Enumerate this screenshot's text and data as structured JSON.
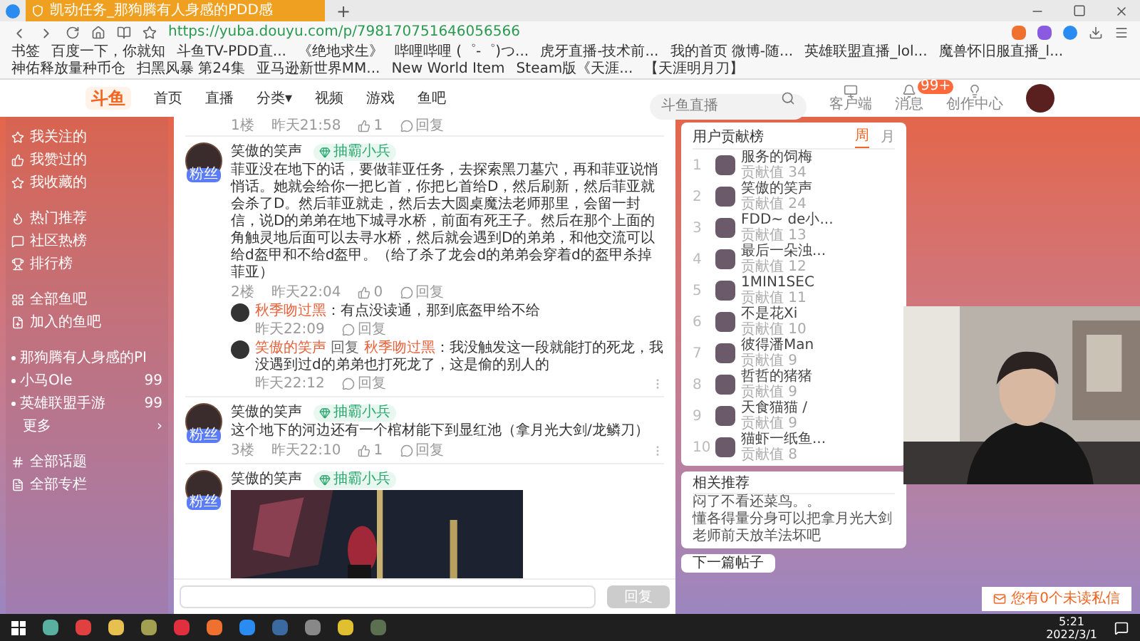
{
  "browser": {
    "tab_title": "凯动任务_那狗腾有人身感的PDD感",
    "new_tab": "+",
    "url": "https://yuba.douyu.com/p/798170751646056566",
    "bookmarks": [
      "书签",
      "百度一下，你就知",
      "斗鱼TV-PDD直...",
      "《绝地求生》",
      "哔哩哔哩 (゜-゜)つ...",
      "虎牙直播-技术前...",
      "我的首页 微博-随...",
      "英雄联盟直播_lol...",
      "魔兽怀旧服直播_l...",
      "神佑释放量种币仓",
      "扫黑风暴 第24集",
      "亚马逊新世界MM...",
      "New World Item",
      "Steam版《天涯...",
      "【天涯明月刀】"
    ]
  },
  "site_header": {
    "logo": "斗鱼",
    "nav": [
      "首页",
      "直播",
      "分类▾",
      "视频",
      "游戏",
      "鱼吧"
    ],
    "search": {
      "placeholder": "斗鱼直播"
    },
    "actions": [
      {
        "label": "客户端"
      },
      {
        "label": "消息",
        "badge": "99+"
      },
      {
        "label": "创作中心"
      }
    ]
  },
  "sidebar": {
    "sections": [
      [
        {
          "label": "我关注的",
          "kind": "link"
        },
        {
          "label": "我赞过的",
          "kind": "link"
        },
        {
          "label": "我收藏的",
          "kind": "link"
        }
      ],
      [
        {
          "label": "热门推荐",
          "kind": "link"
        },
        {
          "label": "社区热榜",
          "kind": "link"
        },
        {
          "label": "排行榜",
          "kind": "link"
        }
      ],
      [
        {
          "label": "全部鱼吧",
          "kind": "link"
        },
        {
          "label": "加入的鱼吧",
          "kind": "link"
        }
      ],
      [
        {
          "label": "那狗腾有人身感的PI",
          "kind": "forum"
        },
        {
          "label": "小马Ole",
          "kind": "forum",
          "count": "99"
        },
        {
          "label": "英雄联盟手游",
          "kind": "forum",
          "count": "99"
        },
        {
          "label": "更多",
          "kind": "more",
          "arrow": "›"
        }
      ],
      [
        {
          "label": "全部话题",
          "kind": "link"
        },
        {
          "label": "全部专栏",
          "kind": "link"
        }
      ]
    ]
  },
  "thread": {
    "top_meta": {
      "floor": "1楼",
      "time": "昨天21:58",
      "likes": "1",
      "reply": "回复"
    },
    "comments": [
      {
        "author": "笑傲的笑声",
        "badge": "抽霸小兵",
        "avatar_tag": "粉丝",
        "text": "菲亚没在地下的话，要做菲亚任务，去探索黑刀墓穴，再和菲亚说悄悄话。她就会给你一把匕首，你把匕首给D，然后刷新，然后菲亚就会杀了D。然后菲亚就走，然后去大圆桌魔法老师那里，会留一封信，说D的弟弟在地下城寻水桥，前面有死王子。然后在那个上面的角触灵地后面可以去寻水桥，然后就会遇到D的弟弟，和他交流可以给d盔甲和不给d盔甲。（给了杀了龙会d的弟弟会穿着d的盔甲杀掉菲亚）",
        "floor": "2楼",
        "time": "昨天22:04",
        "likes": "0",
        "reply": "回复",
        "replies": [
          {
            "author": "秋季吻过黑",
            "text": "：有点没读通，那到底盔甲给不给",
            "time": "昨天22:09",
            "reply": "回复"
          },
          {
            "author": "笑傲的笑声",
            "reply_word": "回复",
            "reply_to": "秋季吻过黑",
            "text": "：我没触发这一段就能打的死龙，我没遇到过d的弟弟也打死龙了，这是偷的别人的",
            "time": "昨天22:12",
            "reply": "回复"
          }
        ]
      },
      {
        "author": "笑傲的笑声",
        "badge": "抽霸小兵",
        "avatar_tag": "粉丝",
        "text": "这个地下的河边还有一个棺材能下到显红池（拿月光大剑/龙鳞刀）",
        "floor": "3楼",
        "time": "昨天22:10",
        "likes": "1",
        "reply": "回复"
      },
      {
        "author": "笑傲的笑声",
        "badge": "抽霸小兵",
        "avatar_tag": "粉丝"
      }
    ],
    "reply_box": {
      "button": "回复"
    }
  },
  "ranking": {
    "title": "用户贡献榜",
    "tabs": [
      {
        "label": "周",
        "selected": true
      },
      {
        "label": "月",
        "selected": false
      }
    ],
    "rows": [
      {
        "rank": "1",
        "name": "服务的饲梅",
        "score": "贡献值 34"
      },
      {
        "rank": "2",
        "name": "笑傲的笑声",
        "score": "贡献值 24"
      },
      {
        "rank": "3",
        "name": "FDD~ de小...",
        "score": "贡献值 13"
      },
      {
        "rank": "4",
        "name": "最后一朵浊...",
        "score": "贡献值 12"
      },
      {
        "rank": "5",
        "name": "1MIN1SEC",
        "score": "贡献值 11"
      },
      {
        "rank": "6",
        "name": "不是花Xi",
        "score": "贡献值 10"
      },
      {
        "rank": "7",
        "name": "彼得潘Man",
        "score": "贡献值 9"
      },
      {
        "rank": "8",
        "name": "哲哲的猪猪",
        "score": "贡献值 9"
      },
      {
        "rank": "9",
        "name": "天食猫猫 /",
        "score": "贡献值 9"
      },
      {
        "rank": "10",
        "name": "猫虾一纸鱼...",
        "score": "贡献值 8"
      }
    ]
  },
  "related": {
    "title": "相关推荐",
    "items": [
      "闷了不看还菜鸟。。",
      "懂各得量分身可以把拿月光大剑",
      "老师前天放羊法坏吧"
    ]
  },
  "next_post": {
    "title": "下一篇帖子"
  },
  "notification": {
    "text": "您有0个未读私信"
  },
  "taskbar": {
    "time": "5:21",
    "date": "2022/3/1"
  }
}
